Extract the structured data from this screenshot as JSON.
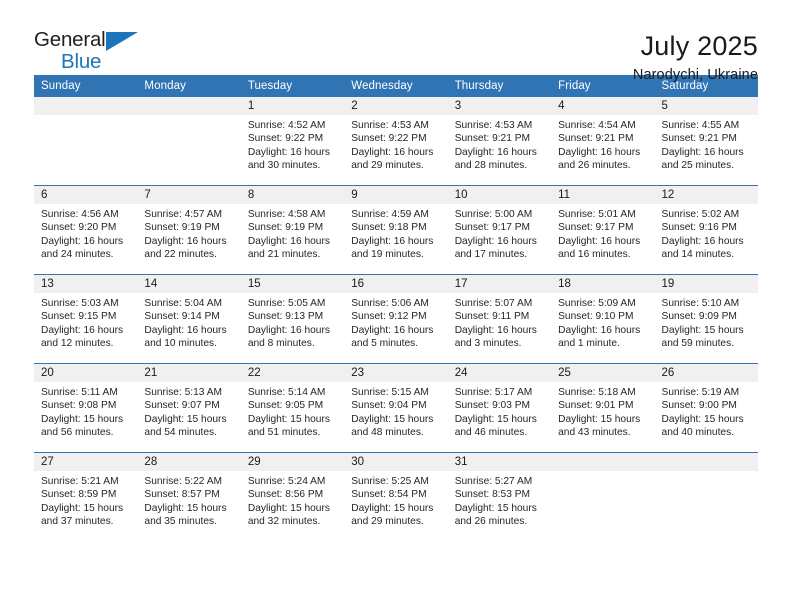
{
  "brand": {
    "name_dark": "General",
    "name_blue": "Blue",
    "accent_color": "#1b75bb"
  },
  "header": {
    "title": "July 2025",
    "location": "Narodychi, Ukraine"
  },
  "calendar": {
    "header_color": "#3174b4",
    "daynum_band_color": "#f0f0f0",
    "weekday_headers": [
      "Sunday",
      "Monday",
      "Tuesday",
      "Wednesday",
      "Thursday",
      "Friday",
      "Saturday"
    ],
    "weeks": [
      [
        {
          "day": "",
          "lines": []
        },
        {
          "day": "",
          "lines": []
        },
        {
          "day": "1",
          "lines": [
            "Sunrise: 4:52 AM",
            "Sunset: 9:22 PM",
            "Daylight: 16 hours",
            "and 30 minutes."
          ]
        },
        {
          "day": "2",
          "lines": [
            "Sunrise: 4:53 AM",
            "Sunset: 9:22 PM",
            "Daylight: 16 hours",
            "and 29 minutes."
          ]
        },
        {
          "day": "3",
          "lines": [
            "Sunrise: 4:53 AM",
            "Sunset: 9:21 PM",
            "Daylight: 16 hours",
            "and 28 minutes."
          ]
        },
        {
          "day": "4",
          "lines": [
            "Sunrise: 4:54 AM",
            "Sunset: 9:21 PM",
            "Daylight: 16 hours",
            "and 26 minutes."
          ]
        },
        {
          "day": "5",
          "lines": [
            "Sunrise: 4:55 AM",
            "Sunset: 9:21 PM",
            "Daylight: 16 hours",
            "and 25 minutes."
          ]
        }
      ],
      [
        {
          "day": "6",
          "lines": [
            "Sunrise: 4:56 AM",
            "Sunset: 9:20 PM",
            "Daylight: 16 hours",
            "and 24 minutes."
          ]
        },
        {
          "day": "7",
          "lines": [
            "Sunrise: 4:57 AM",
            "Sunset: 9:19 PM",
            "Daylight: 16 hours",
            "and 22 minutes."
          ]
        },
        {
          "day": "8",
          "lines": [
            "Sunrise: 4:58 AM",
            "Sunset: 9:19 PM",
            "Daylight: 16 hours",
            "and 21 minutes."
          ]
        },
        {
          "day": "9",
          "lines": [
            "Sunrise: 4:59 AM",
            "Sunset: 9:18 PM",
            "Daylight: 16 hours",
            "and 19 minutes."
          ]
        },
        {
          "day": "10",
          "lines": [
            "Sunrise: 5:00 AM",
            "Sunset: 9:17 PM",
            "Daylight: 16 hours",
            "and 17 minutes."
          ]
        },
        {
          "day": "11",
          "lines": [
            "Sunrise: 5:01 AM",
            "Sunset: 9:17 PM",
            "Daylight: 16 hours",
            "and 16 minutes."
          ]
        },
        {
          "day": "12",
          "lines": [
            "Sunrise: 5:02 AM",
            "Sunset: 9:16 PM",
            "Daylight: 16 hours",
            "and 14 minutes."
          ]
        }
      ],
      [
        {
          "day": "13",
          "lines": [
            "Sunrise: 5:03 AM",
            "Sunset: 9:15 PM",
            "Daylight: 16 hours",
            "and 12 minutes."
          ]
        },
        {
          "day": "14",
          "lines": [
            "Sunrise: 5:04 AM",
            "Sunset: 9:14 PM",
            "Daylight: 16 hours",
            "and 10 minutes."
          ]
        },
        {
          "day": "15",
          "lines": [
            "Sunrise: 5:05 AM",
            "Sunset: 9:13 PM",
            "Daylight: 16 hours",
            "and 8 minutes."
          ]
        },
        {
          "day": "16",
          "lines": [
            "Sunrise: 5:06 AM",
            "Sunset: 9:12 PM",
            "Daylight: 16 hours",
            "and 5 minutes."
          ]
        },
        {
          "day": "17",
          "lines": [
            "Sunrise: 5:07 AM",
            "Sunset: 9:11 PM",
            "Daylight: 16 hours",
            "and 3 minutes."
          ]
        },
        {
          "day": "18",
          "lines": [
            "Sunrise: 5:09 AM",
            "Sunset: 9:10 PM",
            "Daylight: 16 hours",
            "and 1 minute."
          ]
        },
        {
          "day": "19",
          "lines": [
            "Sunrise: 5:10 AM",
            "Sunset: 9:09 PM",
            "Daylight: 15 hours",
            "and 59 minutes."
          ]
        }
      ],
      [
        {
          "day": "20",
          "lines": [
            "Sunrise: 5:11 AM",
            "Sunset: 9:08 PM",
            "Daylight: 15 hours",
            "and 56 minutes."
          ]
        },
        {
          "day": "21",
          "lines": [
            "Sunrise: 5:13 AM",
            "Sunset: 9:07 PM",
            "Daylight: 15 hours",
            "and 54 minutes."
          ]
        },
        {
          "day": "22",
          "lines": [
            "Sunrise: 5:14 AM",
            "Sunset: 9:05 PM",
            "Daylight: 15 hours",
            "and 51 minutes."
          ]
        },
        {
          "day": "23",
          "lines": [
            "Sunrise: 5:15 AM",
            "Sunset: 9:04 PM",
            "Daylight: 15 hours",
            "and 48 minutes."
          ]
        },
        {
          "day": "24",
          "lines": [
            "Sunrise: 5:17 AM",
            "Sunset: 9:03 PM",
            "Daylight: 15 hours",
            "and 46 minutes."
          ]
        },
        {
          "day": "25",
          "lines": [
            "Sunrise: 5:18 AM",
            "Sunset: 9:01 PM",
            "Daylight: 15 hours",
            "and 43 minutes."
          ]
        },
        {
          "day": "26",
          "lines": [
            "Sunrise: 5:19 AM",
            "Sunset: 9:00 PM",
            "Daylight: 15 hours",
            "and 40 minutes."
          ]
        }
      ],
      [
        {
          "day": "27",
          "lines": [
            "Sunrise: 5:21 AM",
            "Sunset: 8:59 PM",
            "Daylight: 15 hours",
            "and 37 minutes."
          ]
        },
        {
          "day": "28",
          "lines": [
            "Sunrise: 5:22 AM",
            "Sunset: 8:57 PM",
            "Daylight: 15 hours",
            "and 35 minutes."
          ]
        },
        {
          "day": "29",
          "lines": [
            "Sunrise: 5:24 AM",
            "Sunset: 8:56 PM",
            "Daylight: 15 hours",
            "and 32 minutes."
          ]
        },
        {
          "day": "30",
          "lines": [
            "Sunrise: 5:25 AM",
            "Sunset: 8:54 PM",
            "Daylight: 15 hours",
            "and 29 minutes."
          ]
        },
        {
          "day": "31",
          "lines": [
            "Sunrise: 5:27 AM",
            "Sunset: 8:53 PM",
            "Daylight: 15 hours",
            "and 26 minutes."
          ]
        },
        {
          "day": "",
          "lines": []
        },
        {
          "day": "",
          "lines": []
        }
      ]
    ]
  }
}
